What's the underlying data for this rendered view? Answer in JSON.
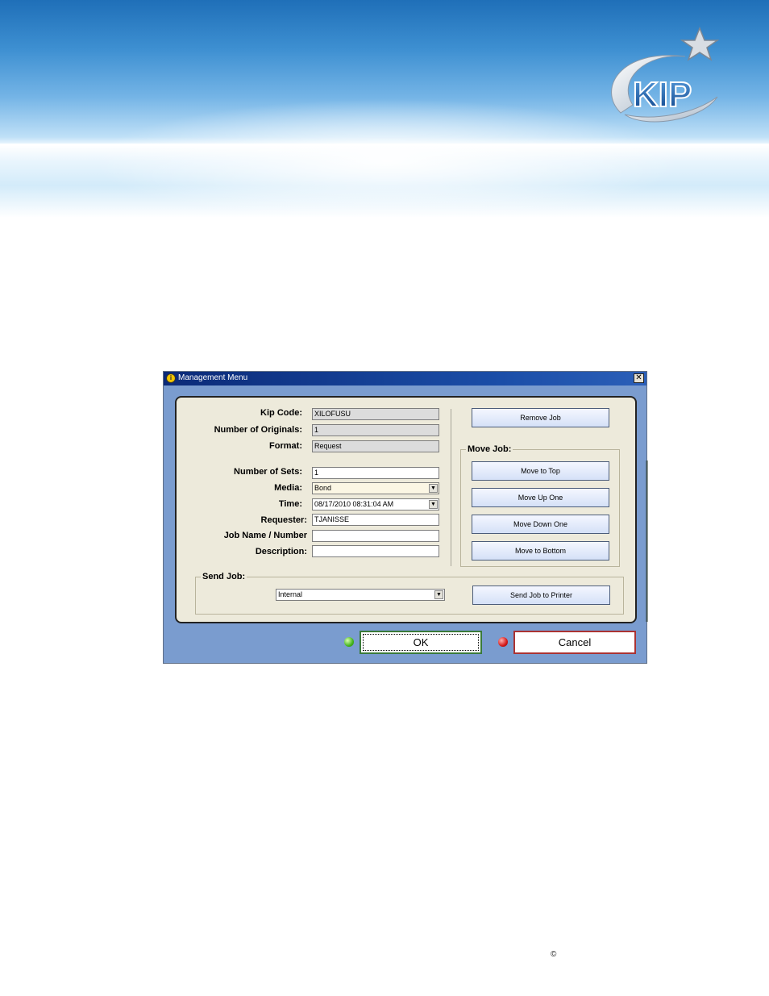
{
  "window": {
    "title": "Management Menu",
    "close_glyph": "✕"
  },
  "fields": {
    "kip_code": {
      "label": "Kip Code:",
      "value": "XILOFUSU"
    },
    "num_originals": {
      "label": "Number of Originals:",
      "value": "1"
    },
    "format": {
      "label": "Format:",
      "value": "Request"
    },
    "num_sets": {
      "label": "Number of Sets:",
      "value": "1"
    },
    "media": {
      "label": "Media:",
      "value": "Bond"
    },
    "time": {
      "label": "Time:",
      "value": "08/17/2010 08:31:04 AM"
    },
    "requester": {
      "label": "Requester:",
      "value": "TJANISSE"
    },
    "job_name": {
      "label": "Job Name / Number",
      "value": ""
    },
    "description": {
      "label": "Description:",
      "value": ""
    }
  },
  "buttons": {
    "remove_job": "Remove Job",
    "move_to_top": "Move to Top",
    "move_up_one": "Move Up One",
    "move_down_one": "Move Down One",
    "move_to_bottom": "Move to Bottom",
    "send_job_to_printer": "Send Job to Printer",
    "ok": "OK",
    "cancel": "Cancel"
  },
  "groups": {
    "move_job": "Move Job:",
    "send_job": "Send Job:"
  },
  "send_job_select": {
    "value": "Internal"
  },
  "logo_text": "KIP",
  "footer": {
    "copyright": "©"
  },
  "colors": {
    "window_bg": "#7a9ccf",
    "panel_bg": "#edeadb",
    "titlebar": "#0b2a78",
    "ok_led": "#44b51e",
    "cancel_led": "#d41a1a"
  }
}
